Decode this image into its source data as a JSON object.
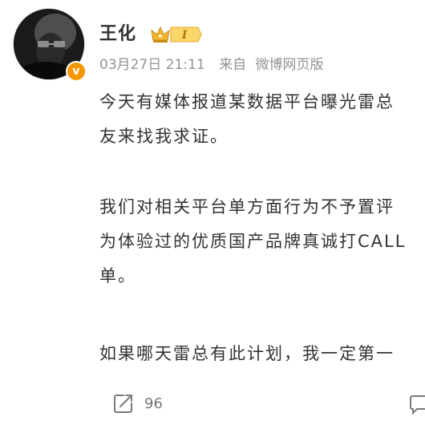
{
  "user": {
    "name": "王化",
    "member_level": "I",
    "verified_mark": "v"
  },
  "meta": {
    "date": "03月27日",
    "time": "21:11",
    "source_prefix": "来自",
    "source_name": "微博网页版"
  },
  "post": {
    "lines": [
      "今天有媒体报道某数据平台曝光雷总",
      "友来找我求证。",
      "我们对相关平台单方面行为不予置评",
      "为体验过的优质国产品牌真诚打CALL",
      "单。",
      "如果哪天雷总有此计划，我一定第一"
    ]
  },
  "actions": {
    "repost_count": "96"
  },
  "colors": {
    "text": "#333333",
    "meta": "#939393",
    "badge_orange": "#f39800",
    "member_gold": "#e8a92a"
  },
  "icons": [
    "crown-icon",
    "repost-icon",
    "verified-icon"
  ]
}
